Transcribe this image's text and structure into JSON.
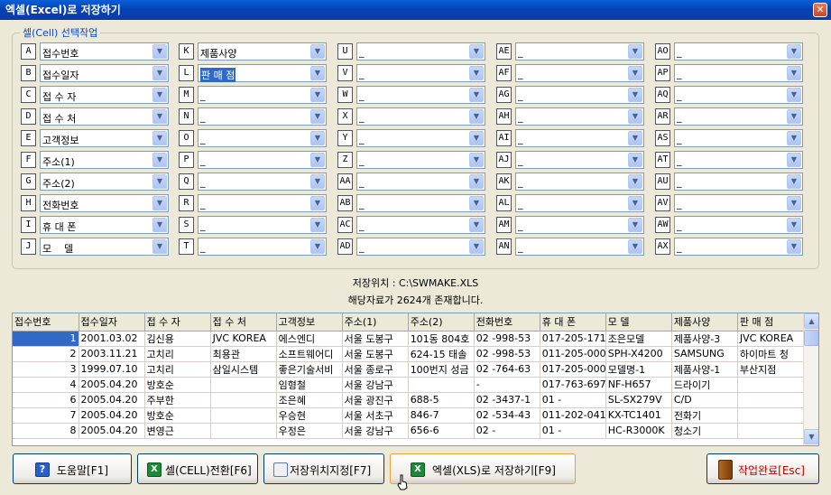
{
  "window": {
    "title": "엑셀(Excel)로 저장하기",
    "close": "✕"
  },
  "group": {
    "legend": "셀(Cell) 선택작업"
  },
  "fields": [
    [
      {
        "key": "A",
        "value": "접수번호"
      },
      {
        "key": "B",
        "value": "접수일자"
      },
      {
        "key": "C",
        "value": "접 수 자"
      },
      {
        "key": "D",
        "value": "접 수 처"
      },
      {
        "key": "E",
        "value": "고객정보"
      },
      {
        "key": "F",
        "value": "주소(1)"
      },
      {
        "key": "G",
        "value": "주소(2)"
      },
      {
        "key": "H",
        "value": "전화번호"
      },
      {
        "key": "I",
        "value": "휴 대 폰"
      },
      {
        "key": "J",
        "value": "모    델"
      }
    ],
    [
      {
        "key": "K",
        "value": "제품사양"
      },
      {
        "key": "L",
        "value": "판 매 점",
        "selected": true
      },
      {
        "key": "M",
        "value": "_"
      },
      {
        "key": "N",
        "value": "_"
      },
      {
        "key": "O",
        "value": "_"
      },
      {
        "key": "P",
        "value": "_"
      },
      {
        "key": "Q",
        "value": "_"
      },
      {
        "key": "R",
        "value": "_"
      },
      {
        "key": "S",
        "value": "_"
      },
      {
        "key": "T",
        "value": "_"
      }
    ],
    [
      {
        "key": "U",
        "value": "_"
      },
      {
        "key": "V",
        "value": "_"
      },
      {
        "key": "W",
        "value": "_"
      },
      {
        "key": "X",
        "value": "_"
      },
      {
        "key": "Y",
        "value": "_"
      },
      {
        "key": "Z",
        "value": "_"
      },
      {
        "key": "AA",
        "value": "_"
      },
      {
        "key": "AB",
        "value": "_"
      },
      {
        "key": "AC",
        "value": "_"
      },
      {
        "key": "AD",
        "value": "_"
      }
    ],
    [
      {
        "key": "AE",
        "value": "_"
      },
      {
        "key": "AF",
        "value": "_"
      },
      {
        "key": "AG",
        "value": "_"
      },
      {
        "key": "AH",
        "value": "_"
      },
      {
        "key": "AI",
        "value": "_"
      },
      {
        "key": "AJ",
        "value": "_"
      },
      {
        "key": "AK",
        "value": "_"
      },
      {
        "key": "AL",
        "value": "_"
      },
      {
        "key": "AM",
        "value": "_"
      },
      {
        "key": "AN",
        "value": "_"
      }
    ],
    [
      {
        "key": "AO",
        "value": "_"
      },
      {
        "key": "AP",
        "value": "_"
      },
      {
        "key": "AQ",
        "value": "_"
      },
      {
        "key": "AR",
        "value": "_"
      },
      {
        "key": "AS",
        "value": "_"
      },
      {
        "key": "AT",
        "value": "_"
      },
      {
        "key": "AU",
        "value": "_"
      },
      {
        "key": "AV",
        "value": "_"
      },
      {
        "key": "AW",
        "value": "_"
      },
      {
        "key": "AX",
        "value": "_"
      }
    ]
  ],
  "info": {
    "location": "저장위치 : C:\\SWMAKE.XLS",
    "count": "해당자료가 2624개 존재합니다."
  },
  "table": {
    "headers": [
      "접수번호",
      "접수일자",
      "접 수 자",
      "접 수 처",
      "고객정보",
      "주소(1)",
      "주소(2)",
      "전화번호",
      "휴 대 폰",
      "모    델",
      "제품사양",
      "판 매 점"
    ],
    "rows": [
      [
        "1",
        "2001.03.02",
        "김신용",
        "JVC KOREA",
        "에스엔디",
        "서울 도봉구",
        "101동 804호",
        "02   -998-53",
        "017-205-171",
        "조은모델",
        "제품사양-3",
        "JVC KOREA"
      ],
      [
        "2",
        "2003.11.21",
        "고치리",
        "최용관",
        "소프트웨어디",
        "서울 도봉구",
        "624-15 태솔",
        "02   -998-53",
        "011-205-000",
        "SPH-X4200",
        "SAMSUNG",
        "하이마트 청"
      ],
      [
        "3",
        "1999.07.10",
        "고치리",
        "삼일시스템",
        "좋은기술서비",
        "서울 종로구",
        "100번지 성금",
        "02   -764-63",
        "017-205-000",
        "모델명-1",
        "제품사양-1",
        "부산지점"
      ],
      [
        "4",
        "2005.04.20",
        "방호순",
        "",
        "임형철",
        "서울 강남구",
        "",
        "   -",
        "017-763-697",
        "NF-H657",
        "드라이기",
        ""
      ],
      [
        "6",
        "2005.04.20",
        "주부한",
        "",
        "조은혜",
        "서울 광진구",
        "688-5",
        "02   -3437-1",
        "01 -",
        "SL-SX279V",
        "C/D",
        ""
      ],
      [
        "7",
        "2005.04.20",
        "방호순",
        "",
        "우승현",
        "서울 서초구",
        "846-7",
        "02   -534-43",
        "011-202-041",
        "KX-TC1401",
        "전화기",
        ""
      ],
      [
        "8",
        "2005.04.20",
        "변영근",
        "",
        "우정은",
        "서울 강남구",
        "656-6",
        "02   -",
        "01 -",
        "HC-R3000K",
        "청소기",
        ""
      ]
    ]
  },
  "buttons": {
    "help": "도움말[F1]",
    "cell": "셀(CELL)전환[F6]",
    "location": "저장위치지정[F7]",
    "save": "엑셀(XLS)로 저장하기[F9]",
    "done": "작업완료[Esc]"
  }
}
